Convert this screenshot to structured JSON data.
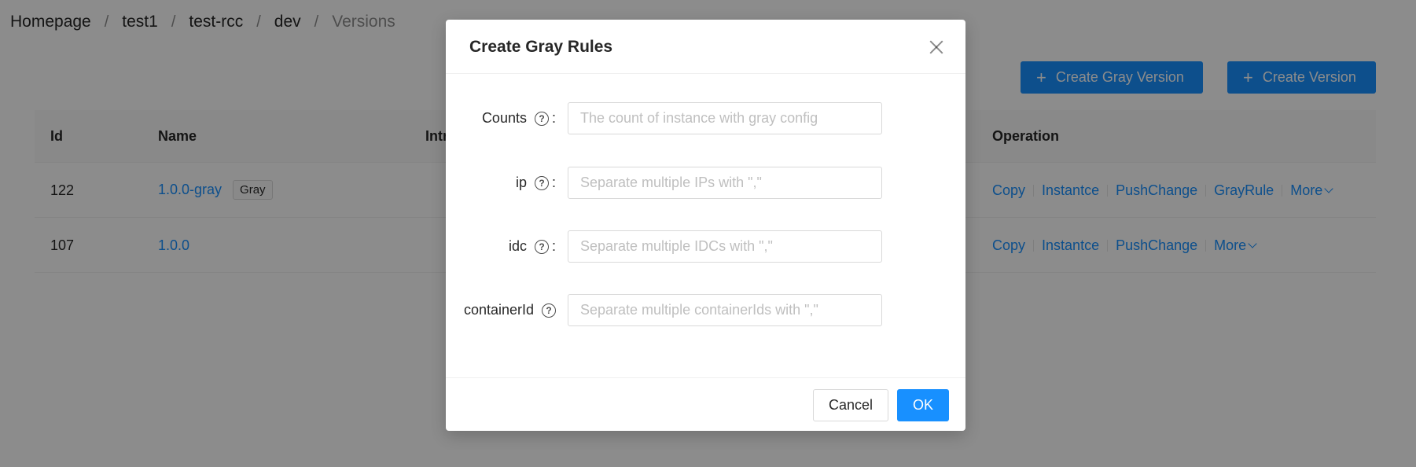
{
  "breadcrumb": [
    "Homepage",
    "test1",
    "test-rcc",
    "dev",
    "Versions"
  ],
  "breadcrumb_separator": "/",
  "actions": {
    "create_gray_version": "Create Gray Version",
    "create_version": "Create Version",
    "plus_glyph": "+"
  },
  "table": {
    "columns": {
      "id": "Id",
      "name": "Name",
      "intro": "Intr",
      "operation": "Operation"
    },
    "rows": [
      {
        "id": "122",
        "name": "1.0.0-gray",
        "tag": "Gray",
        "ops": [
          "Copy",
          "Instantce",
          "PushChange",
          "GrayRule",
          "More"
        ]
      },
      {
        "id": "107",
        "name": "1.0.0",
        "tag": "",
        "ops": [
          "Copy",
          "Instantce",
          "PushChange",
          "More"
        ]
      }
    ]
  },
  "modal": {
    "title": "Create Gray Rules",
    "fields": [
      {
        "label": "Counts",
        "placeholder": "The count of instance with gray config",
        "value": ""
      },
      {
        "label": "ip",
        "placeholder": "Separate multiple IPs with \",\"",
        "value": ""
      },
      {
        "label": "idc",
        "placeholder": "Separate multiple IDCs with \",\"",
        "value": ""
      },
      {
        "label": "containerId",
        "placeholder": "Separate multiple containerIds with \",\"",
        "value": ""
      }
    ],
    "help_glyph": "?",
    "colon": ":",
    "cancel": "Cancel",
    "ok": "OK"
  },
  "colors": {
    "primary": "#1890ff",
    "mask": "rgba(0,0,0,0.45)"
  }
}
